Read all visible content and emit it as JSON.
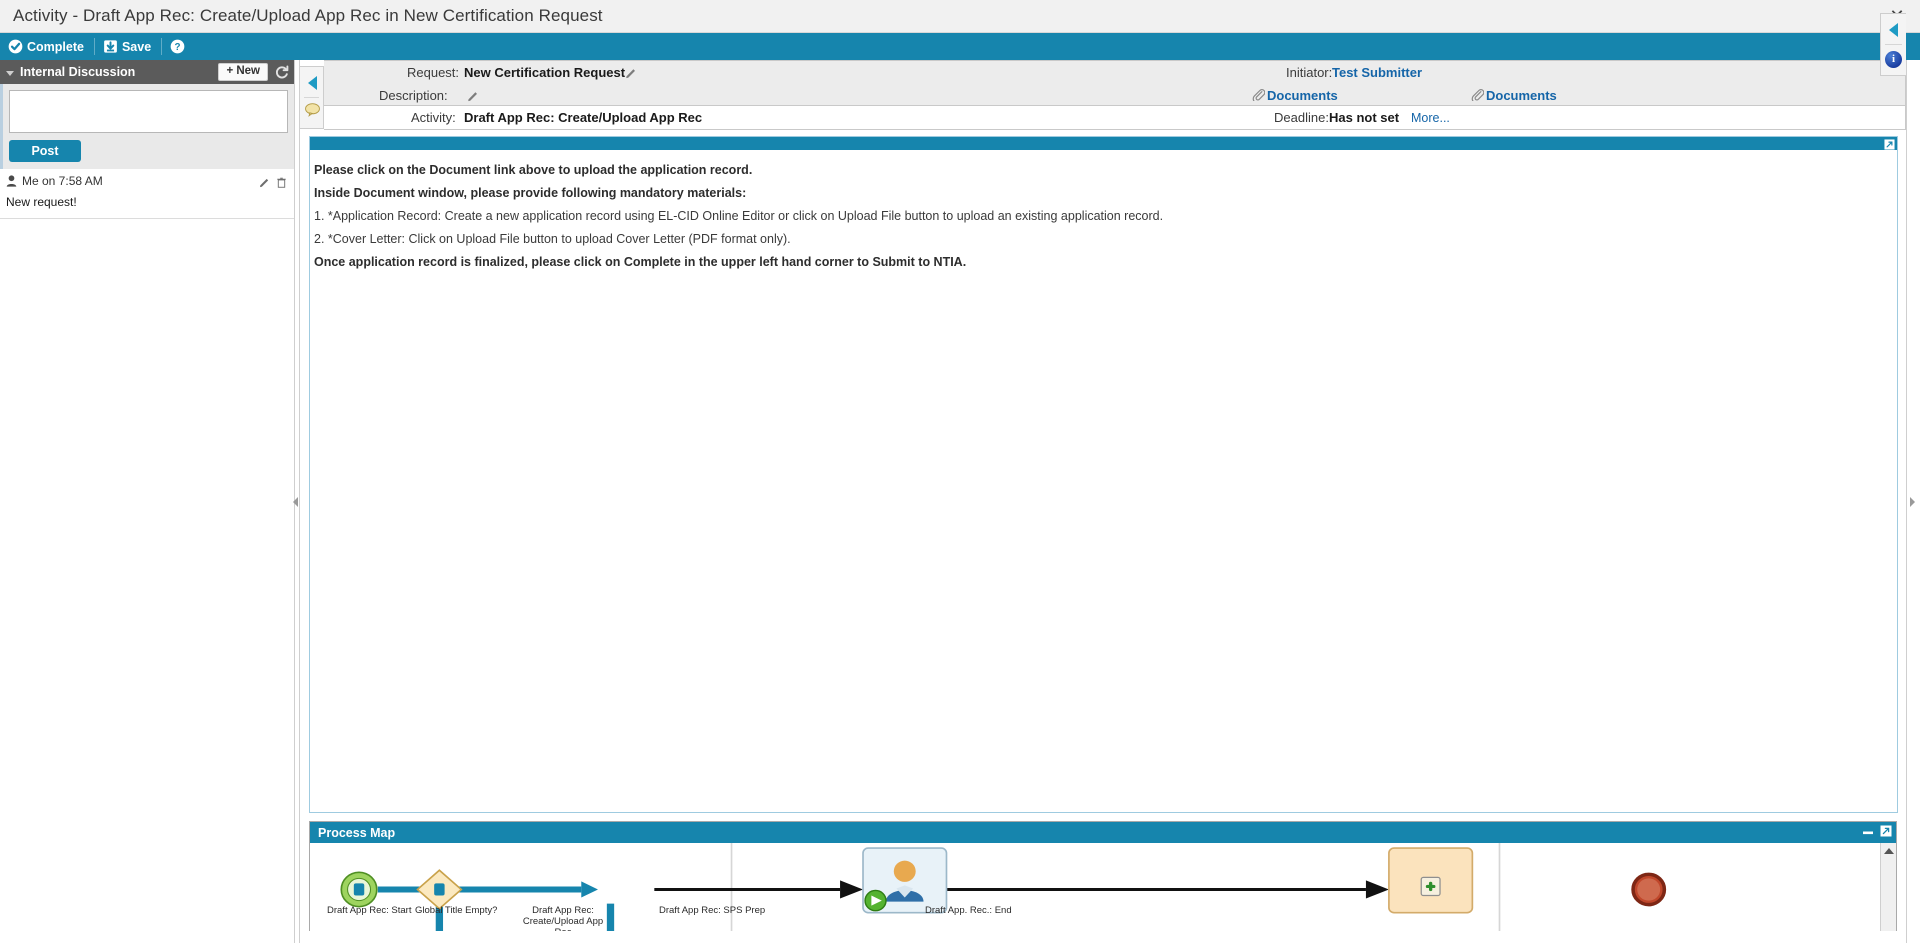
{
  "window": {
    "title": "Activity - Draft App Rec: Create/Upload App Rec in New Certification Request",
    "close_label": "✕"
  },
  "toolbar": {
    "complete_label": "Complete",
    "save_label": "Save",
    "help_label": "?"
  },
  "discussion": {
    "title": "Internal Discussion",
    "new_label": "+ New",
    "compose_placeholder": "",
    "compose_value": "",
    "post_label": "Post",
    "items": [
      {
        "author_time": "Me on 7:58 AM",
        "body": "New request!"
      }
    ]
  },
  "header": {
    "request_label": "Request:",
    "request_value": "New Certification Request",
    "description_label": "Description:",
    "description_value": "",
    "initiator_label": "Initiator:",
    "initiator_value": "Test Submitter",
    "documents_left_label": "Documents",
    "documents_right_label": "Documents",
    "activity_label": "Activity:",
    "activity_value": "Draft App Rec: Create/Upload App Rec",
    "deadline_label": "Deadline:",
    "deadline_value": "Has not set",
    "more_label": "More..."
  },
  "instructions": {
    "lines": [
      {
        "text": "Please click on the Document link above to upload the application record.",
        "bold": true
      },
      {
        "text": "Inside Document window, please provide following mandatory materials:",
        "bold": true
      },
      {
        "text": "1. *Application Record: Create a new application record using EL-CID Online Editor or click on Upload File button to upload an existing application record.",
        "bold": false
      },
      {
        "text": "2. *Cover Letter: Click on Upload File button to upload Cover Letter (PDF format only).",
        "bold": false
      },
      {
        "text": "Once application record is finalized, please click on Complete in the upper left hand corner to Submit to NTIA.",
        "bold": true
      }
    ]
  },
  "process_map": {
    "title": "Process Map",
    "minimize_label": "–",
    "nodes": [
      {
        "id": "start",
        "label": "Draft App Rec: Start",
        "type": "start-event"
      },
      {
        "id": "gateway",
        "label": "Global Title Empty?",
        "type": "gateway"
      },
      {
        "id": "current",
        "label": "Draft App Rec: Create/Upload App Rec",
        "type": "user-task-active"
      },
      {
        "id": "sps",
        "label": "Draft App Rec: SPS Prep",
        "type": "service-task"
      },
      {
        "id": "end",
        "label": "Draft App. Rec.: End",
        "type": "end-event"
      }
    ]
  },
  "colors": {
    "accent": "#1685ad",
    "link": "#1565a8",
    "panel_header": "#5b5b5b",
    "active_node": "#e8f2f8",
    "service_node": "#fbe3bd",
    "start_node": "#8fcf52",
    "end_node": "#c0472b"
  }
}
